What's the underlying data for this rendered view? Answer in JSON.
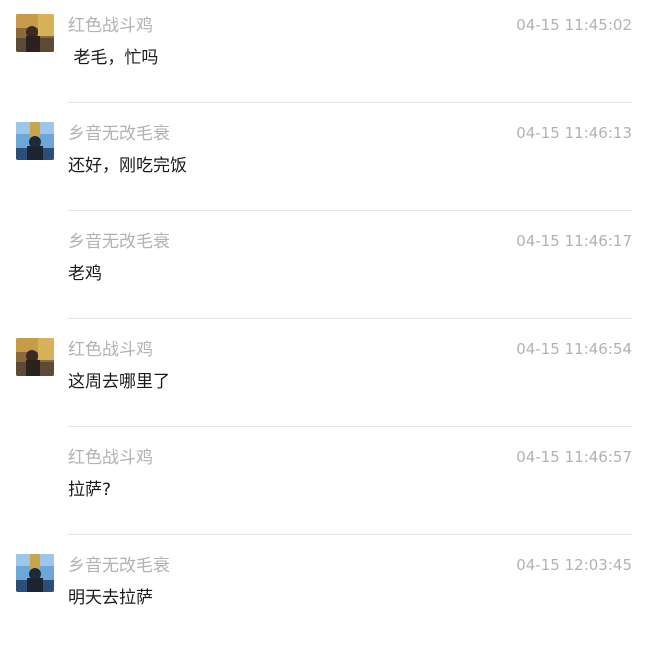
{
  "messages": [
    {
      "sender": "红色战斗鸡",
      "time": "04-15 11:45:02",
      "text": " 老毛，忙吗",
      "avatar": "red-fighting-chicken-avatar"
    },
    {
      "sender": "乡音无改毛衰",
      "time": "04-15 11:46:13",
      "text": "还好，刚吃完饭",
      "avatar": "xiangyin-avatar"
    },
    {
      "sender": "乡音无改毛衰",
      "time": "04-15 11:46:17",
      "text": "老鸡",
      "avatar": ""
    },
    {
      "sender": "红色战斗鸡",
      "time": "04-15 11:46:54",
      "text": "这周去哪里了",
      "avatar": "red-fighting-chicken-avatar"
    },
    {
      "sender": "红色战斗鸡",
      "time": "04-15 11:46:57",
      "text": "拉萨?",
      "avatar": ""
    },
    {
      "sender": "乡音无改毛衰",
      "time": "04-15 12:03:45",
      "text": "明天去拉萨",
      "avatar": "xiangyin-avatar"
    }
  ]
}
